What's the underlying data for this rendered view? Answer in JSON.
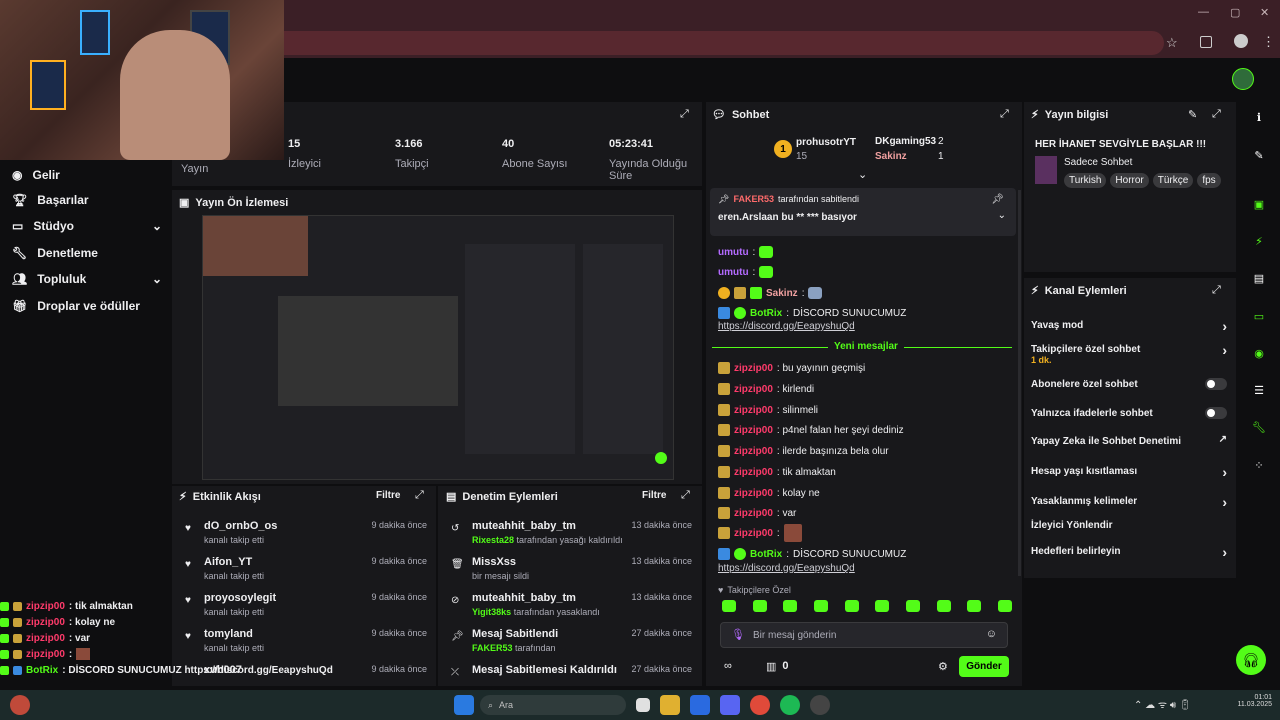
{
  "stream_stats": {
    "partial_label": "Yayın",
    "viewers_value": "15",
    "viewers_label": "İzleyici",
    "followers_value": "3.166",
    "followers_label": "Takipçi",
    "subs_value": "40",
    "subs_label": "Abone Sayısı",
    "uptime_value": "05:23:41",
    "uptime_label": "Yayında Olduğu Süre"
  },
  "sidebar": {
    "items": [
      {
        "label": "Gelir"
      },
      {
        "label": "Başarılar"
      },
      {
        "label": "Stüdyo"
      },
      {
        "label": "Denetleme"
      },
      {
        "label": "Topluluk"
      },
      {
        "label": "Droplar ve ödüller"
      }
    ]
  },
  "preview": {
    "title": "Yayın Ön İzlemesi"
  },
  "activity": {
    "title": "Etkinlik Akışı",
    "filter": "Filtre",
    "rows": [
      {
        "name": "dO_ornbO_os",
        "sub": "kanalı takip etti",
        "time": "9 dakika önce"
      },
      {
        "name": "Aifon_YT",
        "sub": "kanalı takip etti",
        "time": "9 dakika önce"
      },
      {
        "name": "proyosoylegit",
        "sub": "kanalı takip etti",
        "time": "9 dakika önce"
      },
      {
        "name": "tomyland",
        "sub": "kanalı takip etti",
        "time": "9 dakika önce"
      },
      {
        "name": "xuh007",
        "sub": "",
        "time": "9 dakika önce"
      }
    ]
  },
  "moderation": {
    "title": "Denetim Eylemleri",
    "filter": "Filtre",
    "rows": [
      {
        "name": "muteahhit_baby_tm",
        "actor": "Rixesta28",
        "sub": "tarafından yasağı kaldırıldı",
        "time": "13 dakika önce"
      },
      {
        "name": "MissXss",
        "actor": "",
        "sub": "bir mesajı sildi",
        "time": "13 dakika önce"
      },
      {
        "name": "muteahhit_baby_tm",
        "actor": "Yigit38ks",
        "sub": "tarafından yasaklandı",
        "time": "13 dakika önce"
      },
      {
        "name": "Mesaj Sabitlendi",
        "actor": "FAKER53",
        "sub": "tarafından",
        "time": "27 dakika önce"
      },
      {
        "name": "Mesaj Sabitlemesi Kaldırıldı",
        "actor": "",
        "sub": "",
        "time": "27 dakika önce"
      }
    ]
  },
  "chat": {
    "title": "Sohbet",
    "top_users": [
      {
        "rank": "1",
        "name": "prohusotrYT",
        "value": "15"
      },
      {
        "name": "DKgaming53",
        "value": "2"
      },
      {
        "name": "Sakinz",
        "value": "1"
      }
    ],
    "pinned_by": "FAKER53",
    "pinned_by_suffix": "tarafından sabitlendi",
    "pinned_text": "eren.Arslaan bu ** *** basıyor",
    "messages_top": [
      {
        "user": "umutu",
        "text": ":"
      },
      {
        "user": "umutu",
        "text": ":"
      },
      {
        "user": "Sakinz",
        "text": ":"
      }
    ],
    "botrix_name": "BotRix",
    "botrix_text": "DİSCORD SUNUCUMUZ",
    "botrix_link": "https://discord.gg/EeapyshuQd",
    "new_messages_label": "Yeni mesajlar",
    "zip_user": "zipzip00",
    "zip_messages": [
      ": bu yayının geçmişi",
      ": kirlendi",
      ": silinmeli",
      ": p4nel falan her şeyi dediniz",
      ": ilerde başınıza bela olur",
      ": tik almaktan",
      ": kolay ne",
      ": var",
      ":"
    ],
    "followers_only_label": "Takipçilere Özel",
    "input_placeholder": "Bir mesaj gönderin",
    "points_value": "0",
    "send_label": "Gönder"
  },
  "stream_info": {
    "title": "Yayın bilgisi",
    "stream_title": "HER İHANET SEVGİYLE BAŞLAR !!!",
    "category": "Sadece Sohbet",
    "tags": [
      "Turkish",
      "Horror",
      "Türkçe",
      "fps"
    ]
  },
  "channel_actions": {
    "title": "Kanal Eylemleri",
    "items": [
      {
        "label": "Yavaş mod",
        "sub": ""
      },
      {
        "label": "Takipçilere özel sohbet",
        "sub": "1 dk."
      },
      {
        "label": "Abonelere özel sohbet",
        "sub": ""
      },
      {
        "label": "Yalnızca ifadelerle sohbet",
        "sub": ""
      },
      {
        "label": "Yapay Zeka ile Sohbet Denetimi",
        "sub": ""
      },
      {
        "label": "Hesap yaşı kısıtlaması",
        "sub": ""
      },
      {
        "label": "Yasaklanmış kelimeler",
        "sub": ""
      },
      {
        "label": "İzleyici Yönlendir",
        "sub": ""
      },
      {
        "label": "Hedefleri belirleyin",
        "sub": ""
      }
    ]
  },
  "overlay_chat": [
    {
      "user": "zipzip00",
      "text": ": tik almaktan"
    },
    {
      "user": "zipzip00",
      "text": ": kolay ne"
    },
    {
      "user": "zipzip00",
      "text": ": var"
    },
    {
      "user": "zipzip00",
      "text": ":"
    },
    {
      "user": "BotRix",
      "text": ": DİSCORD SUNUCUMUZ https://discord.gg/EeapyshuQd"
    }
  ],
  "taskbar": {
    "search_placeholder": "Ara",
    "time": "01:01",
    "date": "11.03.2025"
  },
  "colors": {
    "accent": "#53fc18",
    "username": "#ff3b6b",
    "panel": "#18181b",
    "background": "#0e0e10"
  }
}
